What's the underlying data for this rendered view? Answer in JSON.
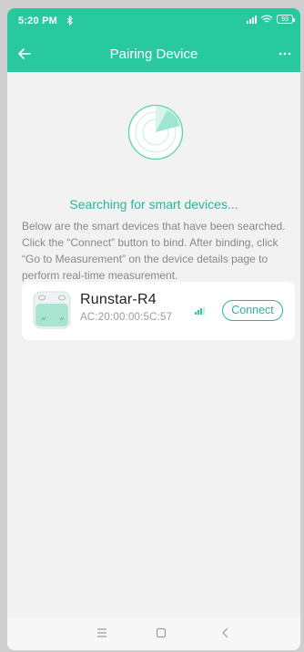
{
  "status_bar": {
    "time": "5:20 PM",
    "bluetooth_icon": "bluetooth-icon",
    "battery_level": "93"
  },
  "header": {
    "title": "Pairing Device",
    "back_icon": "arrow-left-icon",
    "more_icon": "more-horizontal-icon",
    "background": "#29c9a0"
  },
  "search": {
    "status_text": "Searching for smart devices...",
    "description": "Below are the smart devices that have been searched. Click the “Connect” button to bind. After binding, click “Go to Measurement” on the device details page to perform real-time measurement.",
    "accent_color": "#2bb59a"
  },
  "devices": [
    {
      "name": "Runstar-R4",
      "mac": "AC:20:00:00:5C:57",
      "connect_label": "Connect",
      "icon": "smart-scale-icon"
    }
  ],
  "bottom_nav": {
    "menu_icon": "menu-icon",
    "home_icon": "home-square-icon",
    "back_icon": "chevron-left-icon"
  }
}
